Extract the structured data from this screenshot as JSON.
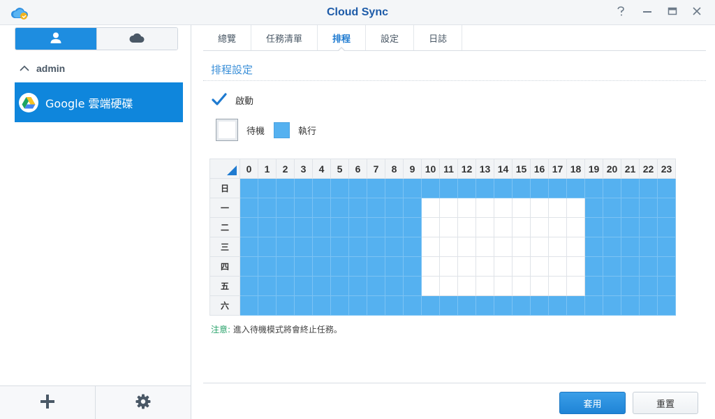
{
  "window": {
    "title": "Cloud Sync",
    "icons": {
      "app": "cloud-sync-app-icon",
      "help": "help-icon",
      "minimize": "minimize-icon",
      "maximize": "maximize-icon",
      "close": "close-icon"
    }
  },
  "sidebar": {
    "segments": [
      {
        "icon": "user-icon",
        "active": true
      },
      {
        "icon": "cloud-icon",
        "active": false
      }
    ],
    "group": {
      "label": "admin",
      "icon": "chevron-up-icon"
    },
    "accounts": [
      {
        "label": "Google 雲端硬碟",
        "icon": "google-drive-icon",
        "selected": true
      }
    ],
    "footer": {
      "add_icon": "plus-icon",
      "settings_icon": "gear-icon"
    }
  },
  "tabs": [
    {
      "label": "總覽",
      "active": false
    },
    {
      "label": "任務清單",
      "active": false
    },
    {
      "label": "排程",
      "active": true
    },
    {
      "label": "設定",
      "active": false
    },
    {
      "label": "日誌",
      "active": false
    }
  ],
  "schedule": {
    "section_title": "排程設定",
    "enable_label": "啟動",
    "enabled": true,
    "legend": {
      "standby": "待機",
      "run": "執行"
    },
    "hours": [
      "0",
      "1",
      "2",
      "3",
      "4",
      "5",
      "6",
      "7",
      "8",
      "9",
      "10",
      "11",
      "12",
      "13",
      "14",
      "15",
      "16",
      "17",
      "18",
      "19",
      "20",
      "21",
      "22",
      "23"
    ],
    "days": [
      "日",
      "一",
      "二",
      "三",
      "四",
      "五",
      "六"
    ],
    "grid": [
      [
        1,
        1,
        1,
        1,
        1,
        1,
        1,
        1,
        1,
        1,
        1,
        1,
        1,
        1,
        1,
        1,
        1,
        1,
        1,
        1,
        1,
        1,
        1,
        1
      ],
      [
        1,
        1,
        1,
        1,
        1,
        1,
        1,
        1,
        1,
        1,
        0,
        0,
        0,
        0,
        0,
        0,
        0,
        0,
        0,
        1,
        1,
        1,
        1,
        1
      ],
      [
        1,
        1,
        1,
        1,
        1,
        1,
        1,
        1,
        1,
        1,
        0,
        0,
        0,
        0,
        0,
        0,
        0,
        0,
        0,
        1,
        1,
        1,
        1,
        1
      ],
      [
        1,
        1,
        1,
        1,
        1,
        1,
        1,
        1,
        1,
        1,
        0,
        0,
        0,
        0,
        0,
        0,
        0,
        0,
        0,
        1,
        1,
        1,
        1,
        1
      ],
      [
        1,
        1,
        1,
        1,
        1,
        1,
        1,
        1,
        1,
        1,
        0,
        0,
        0,
        0,
        0,
        0,
        0,
        0,
        0,
        1,
        1,
        1,
        1,
        1
      ],
      [
        1,
        1,
        1,
        1,
        1,
        1,
        1,
        1,
        1,
        1,
        0,
        0,
        0,
        0,
        0,
        0,
        0,
        0,
        0,
        1,
        1,
        1,
        1,
        1
      ],
      [
        1,
        1,
        1,
        1,
        1,
        1,
        1,
        1,
        1,
        1,
        1,
        1,
        1,
        1,
        1,
        1,
        1,
        1,
        1,
        1,
        1,
        1,
        1,
        1
      ]
    ],
    "note_label": "注意:",
    "note_text": "進入待機模式將會終止任務。"
  },
  "buttons": {
    "apply": "套用",
    "reset": "重置"
  },
  "colors": {
    "accent": "#1e8de0",
    "run_cell": "#55b1f0",
    "title": "#1d5ba8"
  }
}
